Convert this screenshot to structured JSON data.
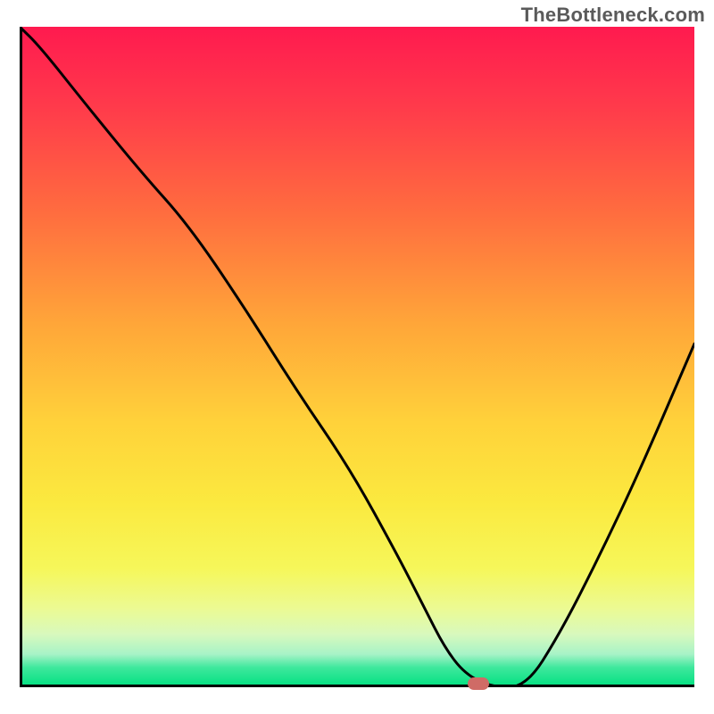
{
  "watermark": "TheBottleneck.com",
  "colors": {
    "gradient_top_red": "#ff1a4f",
    "gradient_bottom_green": "#00e080",
    "curve_stroke": "#000000",
    "axis_stroke": "#000000",
    "marker_fill": "#cf6b66",
    "watermark_text": "#5a5a5a"
  },
  "chart_data": {
    "type": "line",
    "title": "",
    "xlabel": "",
    "ylabel": "",
    "xlim": [
      0,
      100
    ],
    "ylim": [
      0,
      100
    ],
    "grid": false,
    "legend_position": "none",
    "background": "vertical red→green gradient (bottleneck severity)",
    "series": [
      {
        "name": "bottleneck-curve",
        "x": [
          0,
          3,
          10,
          18,
          25,
          33,
          41,
          49,
          56,
          60,
          63,
          66,
          70,
          75,
          80,
          86,
          92,
          100
        ],
        "values": [
          100,
          97,
          88,
          78,
          70,
          58,
          45,
          33,
          20,
          12,
          6,
          2,
          0,
          0,
          8,
          20,
          33,
          52
        ]
      }
    ],
    "marker": {
      "x": 68,
      "y": 0,
      "meaning": "optimal / no-bottleneck point"
    },
    "annotations": [
      {
        "text": "TheBottleneck.com",
        "position": "top-right"
      }
    ]
  }
}
